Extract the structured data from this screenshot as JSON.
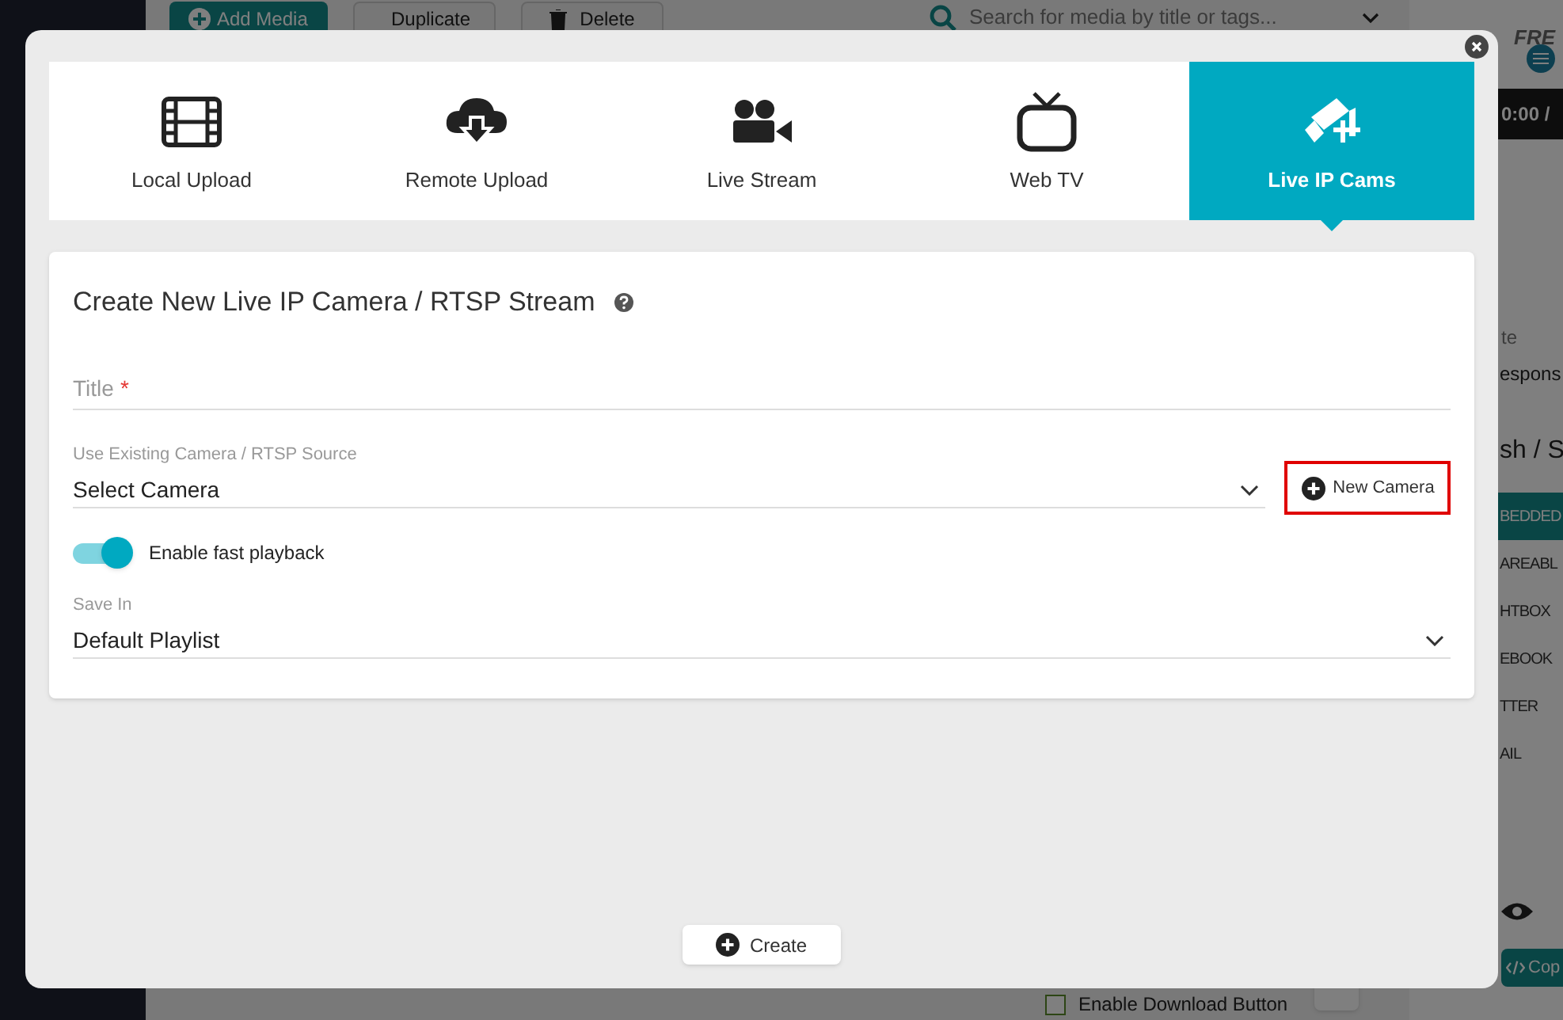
{
  "backdrop": {
    "toolbar_buttons": [
      {
        "label": "Add Media",
        "kind": "primary"
      },
      {
        "label": "Duplicate",
        "kind": "copy"
      },
      {
        "label": "Delete",
        "kind": "trash"
      }
    ],
    "search": {
      "placeholder": "Search for media by title or tags..."
    },
    "right_panel": {
      "brand": "FRE",
      "time": "0:00 /",
      "field_label": "te",
      "field_value": "espons",
      "heading": "sh / S",
      "share_items": [
        {
          "label": "BEDDED",
          "selected": true
        },
        {
          "label": "AREABL",
          "selected": false
        },
        {
          "label": "HTBOX",
          "selected": false
        },
        {
          "label": "EBOOK",
          "selected": false
        },
        {
          "label": "TTER",
          "selected": false
        },
        {
          "label": "AIL",
          "selected": false
        }
      ],
      "copy_button": "Cop"
    },
    "download_option": {
      "label": "Enable Download Button",
      "checked": false
    }
  },
  "dialog": {
    "tabs": [
      {
        "label": "Local Upload",
        "selected": false
      },
      {
        "label": "Remote Upload",
        "selected": false
      },
      {
        "label": "Live Stream",
        "selected": false
      },
      {
        "label": "Web TV",
        "selected": false
      },
      {
        "label": "Live IP Cams",
        "selected": true
      }
    ],
    "form": {
      "title": "Create New Live IP Camera / RTSP Stream",
      "title_field": {
        "placeholder": "Title",
        "required": true,
        "required_mark": "*"
      },
      "camera_select": {
        "label": "Use Existing Camera / RTSP Source",
        "value": "Select Camera"
      },
      "new_camera_button": {
        "label": "New Camera",
        "highlighted": true
      },
      "fast_playback": {
        "label": "Enable fast playback",
        "on": true
      },
      "save_in": {
        "label": "Save In",
        "value": "Default Playlist"
      }
    },
    "create_button": "Create"
  }
}
